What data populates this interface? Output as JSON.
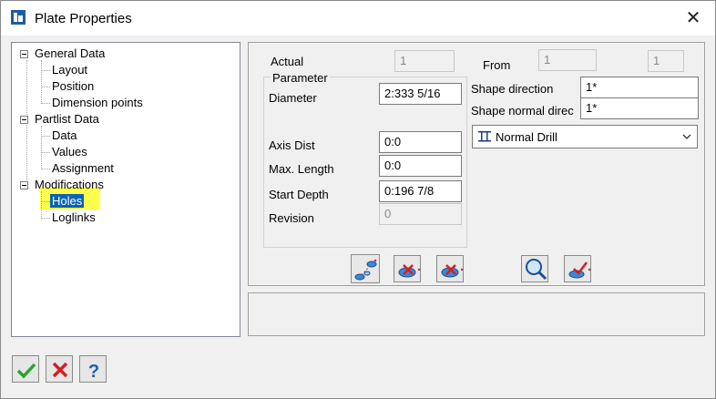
{
  "window": {
    "title": "Plate Properties",
    "close_glyph": "✕"
  },
  "tree": {
    "general": {
      "label": "General Data",
      "children": [
        "Layout",
        "Position",
        "Dimension points"
      ]
    },
    "partlist": {
      "label": "Partlist Data",
      "children": [
        "Data",
        "Values",
        "Assignment"
      ]
    },
    "modifications": {
      "label": "Modifications",
      "children": [
        "Holes",
        "Loglinks"
      ]
    },
    "selected": "Holes",
    "highlight_color": "#ffff4d",
    "selection_color": "#0a64b0"
  },
  "params": {
    "actual_label": "Actual",
    "actual_value": "1",
    "from_label": "From",
    "from_value": "1",
    "from_value2": "1",
    "group_label": "Parameter",
    "diameter_label": "Diameter",
    "diameter_value": "2:333 5/16",
    "axis_dist_label": "Axis Dist",
    "axis_dist_value": "0:0",
    "max_length_label": "Max. Length",
    "max_length_value": "0:0",
    "start_depth_label": "Start Depth",
    "start_depth_value": "0:196 7/8",
    "revision_label": "Revision",
    "revision_value": "0",
    "shape_direction_label": "Shape direction",
    "shape_direction_value": "1*",
    "shape_normal_label": "Shape normal direc",
    "shape_normal_value": "1*",
    "drill_type_value": "Normal Drill"
  },
  "toolbar": [
    "hole-pattern-icon",
    "hole-delete-icon",
    "hole-delete-alt-icon",
    "zoom-icon",
    "hole-check-icon"
  ],
  "buttons": [
    "ok-icon",
    "cancel-icon",
    "help-icon"
  ]
}
